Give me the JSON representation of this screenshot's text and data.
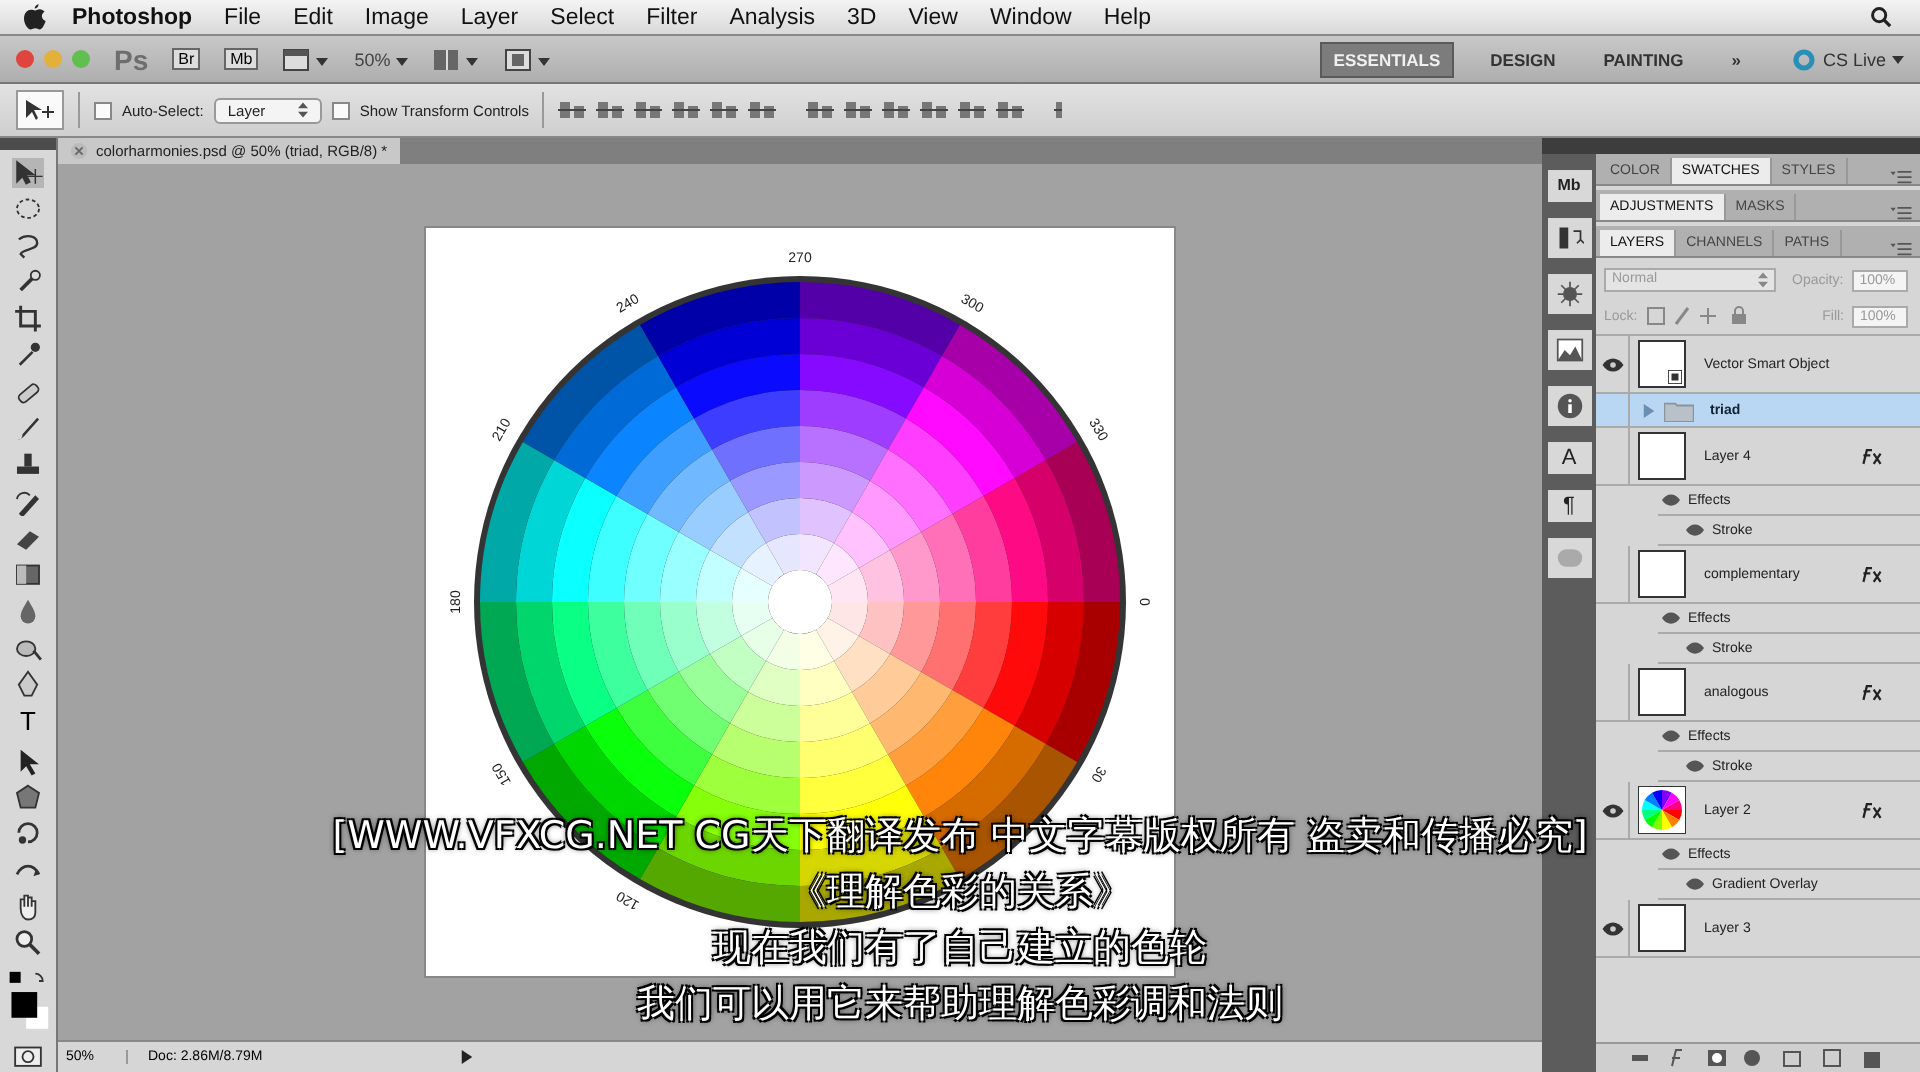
{
  "menubar": {
    "app": "Photoshop",
    "items": [
      "File",
      "Edit",
      "Image",
      "Layer",
      "Select",
      "Filter",
      "Analysis",
      "3D",
      "View",
      "Window",
      "Help"
    ]
  },
  "appbar": {
    "ps": "Ps",
    "bridge": "Br",
    "mini_bridge": "Mb",
    "zoom": "50%",
    "workspaces": [
      {
        "label": "ESSENTIALS",
        "selected": true
      },
      {
        "label": "DESIGN",
        "selected": false
      },
      {
        "label": "PAINTING",
        "selected": false
      }
    ],
    "more": "»",
    "cs_live": "CS Live"
  },
  "options": {
    "auto_select": {
      "label": "Auto-Select:",
      "checked": false
    },
    "target": "Layer",
    "transform": {
      "label": "Show Transform Controls",
      "checked": false
    }
  },
  "tools": {
    "type_glyph": "T"
  },
  "document": {
    "tab": "colorharmonies.psd @ 50% (triad, RGB/8) *",
    "wheel_labels": [
      "0",
      "30",
      "120",
      "150",
      "180",
      "210",
      "240",
      "270",
      "300",
      "330"
    ],
    "zoom": "50%",
    "doc_info": "Doc: 2.86M/8.79M"
  },
  "dock": [
    {
      "kind": "glyph",
      "text": "Mb"
    },
    {
      "kind": "icon"
    },
    {
      "kind": "icon"
    },
    {
      "kind": "icon"
    },
    {
      "kind": "icon"
    },
    {
      "kind": "glyph",
      "text": "A"
    },
    {
      "kind": "glyph",
      "text": "¶"
    },
    {
      "kind": "icon"
    }
  ],
  "panel_groups": [
    {
      "tabs": [
        {
          "label": "COLOR",
          "selected": false
        },
        {
          "label": "SWATCHES",
          "selected": true
        },
        {
          "label": "STYLES",
          "selected": false
        }
      ]
    },
    {
      "tabs": [
        {
          "label": "ADJUSTMENTS",
          "selected": true
        },
        {
          "label": "MASKS",
          "selected": false
        }
      ]
    },
    {
      "tabs": [
        {
          "label": "LAYERS",
          "selected": true
        },
        {
          "label": "CHANNELS",
          "selected": false
        },
        {
          "label": "PATHS",
          "selected": false
        }
      ]
    }
  ],
  "layers": {
    "blend_mode": "Normal",
    "opacity_label": "Opacity:",
    "opacity": "100%",
    "lock_label": "Lock:",
    "fill_label": "Fill:",
    "fill": "100%",
    "items": [
      {
        "kind": "smart_object",
        "name": "Vector Smart Object",
        "visible": true,
        "selected": false,
        "thumbnail": {
          "kind": "blank"
        },
        "fx": false
      },
      {
        "kind": "group",
        "name": "triad",
        "visible": false,
        "selected": true,
        "expanded": false
      },
      {
        "kind": "layer",
        "name": "Layer 4",
        "visible": false,
        "selected": false,
        "thumbnail": {
          "kind": "blank"
        },
        "fx": true,
        "effects_label": "Effects",
        "effects": [
          "Stroke"
        ]
      },
      {
        "kind": "layer",
        "name": "complementary",
        "visible": false,
        "selected": false,
        "thumbnail": {
          "kind": "blank"
        },
        "fx": true,
        "effects_label": "Effects",
        "effects": [
          "Stroke"
        ]
      },
      {
        "kind": "layer",
        "name": "analogous",
        "visible": false,
        "selected": false,
        "thumbnail": {
          "kind": "blank"
        },
        "fx": true,
        "effects_label": "Effects",
        "effects": [
          "Stroke"
        ]
      },
      {
        "kind": "layer",
        "name": "Layer 2",
        "visible": true,
        "selected": false,
        "thumbnail": {
          "kind": "color_wheel"
        },
        "fx": true,
        "effects_label": "Effects",
        "effects": [
          "Gradient Overlay"
        ]
      },
      {
        "kind": "layer",
        "name": "Layer 3",
        "visible": true,
        "selected": false,
        "thumbnail": {
          "kind": "blank"
        },
        "fx": false
      }
    ]
  },
  "subtitles": [
    "[WWW.VFXCG.NET CG天下翻译发布 中文字幕版权所有 盗卖和传播必究]",
    "《理解色彩的关系》",
    "现在我们有了自己建立的色轮",
    "我们可以用它来帮助理解色彩调和法则"
  ]
}
